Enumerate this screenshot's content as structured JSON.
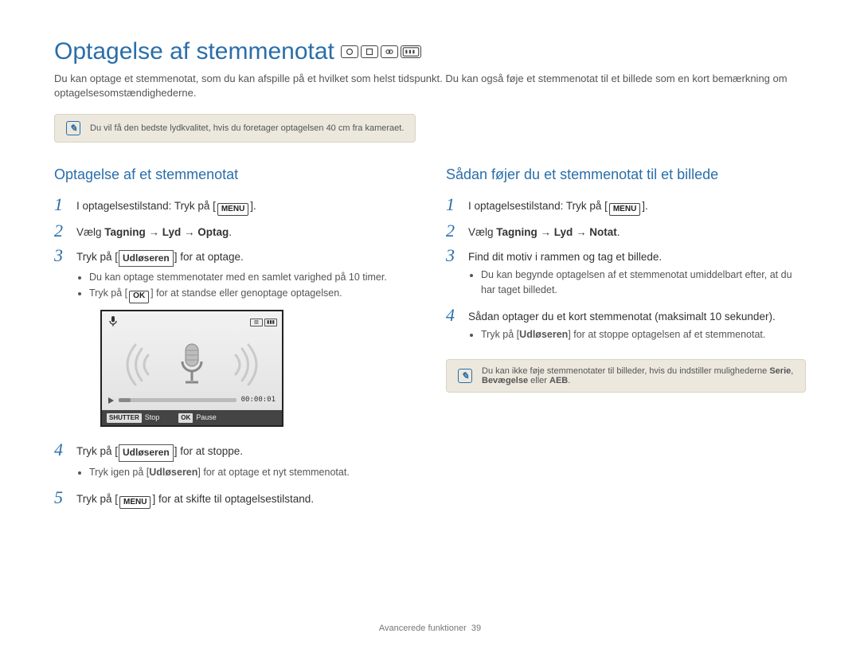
{
  "page_title": "Optagelse af stemmenotat",
  "intro": "Du kan optage et stemmenotat, som du kan afspille på et hvilket som helst tidspunkt. Du kan også føje et stemmenotat til et billede som en kort bemærkning om optagelsesomstændighederne.",
  "top_note": "Du vil få den bedste lydkvalitet, hvis du foretager optagelsen 40 cm fra kameraet.",
  "left": {
    "heading": "Optagelse af et stemmenotat",
    "s1": "I optagelsestilstand: Tryk på [",
    "s1_btn": "MENU",
    "s1_end": "].",
    "s2_pre": "Vælg ",
    "s2_bold": "Tagning → Lyd → Optag",
    "s2_post": ".",
    "s3_pre": "Tryk på [",
    "s3_bold": "Udløseren",
    "s3_post": "] for at optage.",
    "s3_b1": "Du kan optage stemmenotater med en samlet varighed på 10 timer.",
    "s3_b2_pre": "Tryk på [",
    "s3_b2_btn": "OK",
    "s3_b2_post": "] for at standse eller genoptage optagelsen.",
    "screen_time": "00:00:01",
    "screen_stop": "Stop",
    "screen_stop_tag": "SHUTTER",
    "screen_pause": "Pause",
    "screen_pause_tag": "OK",
    "s4_pre": "Tryk på [",
    "s4_bold": "Udløseren",
    "s4_post": "] for at stoppe.",
    "s4_b1_pre": "Tryk igen på [",
    "s4_b1_bold": "Udløseren",
    "s4_b1_post": "] for at optage et nyt stemmenotat.",
    "s5_pre": "Tryk på [",
    "s5_btn": "MENU",
    "s5_post": "] for at skifte til optagelsestilstand."
  },
  "right": {
    "heading": "Sådan føjer du et stemmenotat til et billede",
    "s1": "I optagelsestilstand: Tryk på [",
    "s1_btn": "MENU",
    "s1_end": "].",
    "s2_pre": "Vælg ",
    "s2_bold": "Tagning → Lyd → Notat",
    "s2_post": ".",
    "s3": "Find dit motiv i rammen og tag et billede.",
    "s3_b1": "Du kan begynde optagelsen af et stemmenotat umiddelbart efter, at du har taget billedet.",
    "s4": "Sådan optager du et kort stemmenotat (maksimalt 10 sekunder).",
    "s4_b1_pre": "Tryk på [",
    "s4_b1_bold": "Udløseren",
    "s4_b1_post": "] for at stoppe optagelsen af et stemmenotat.",
    "note_l1": "Du kan ikke føje stemmenotater til billeder, hvis du indstiller mulighederne ",
    "note_bold1": "Serie",
    "note_mid": ", ",
    "note_bold2": "Bevægelse",
    "note_mid2": " eller ",
    "note_bold3": "AEB",
    "note_end": "."
  },
  "footer_label": "Avancerede funktioner",
  "footer_page": "39"
}
